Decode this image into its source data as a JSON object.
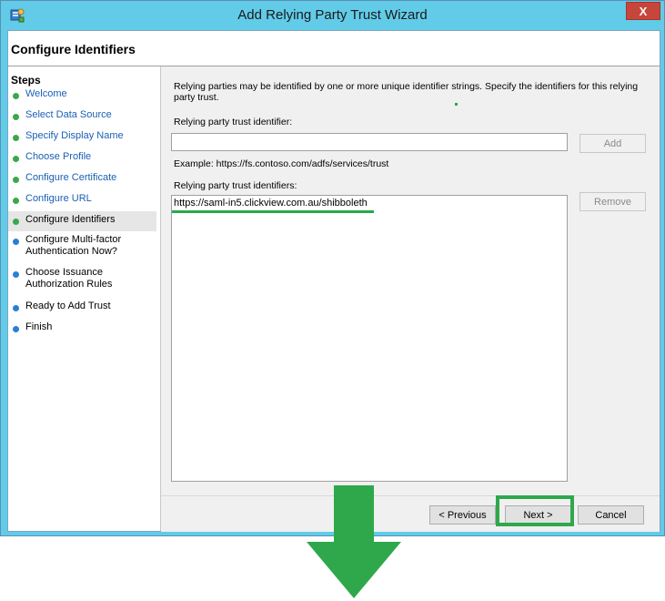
{
  "window": {
    "title": "Add Relying Party Trust Wizard",
    "close_label": "X"
  },
  "header": {
    "title": "Configure Identifiers"
  },
  "steps": {
    "title": "Steps",
    "items": [
      {
        "label": "Welcome",
        "state": "done"
      },
      {
        "label": "Select Data Source",
        "state": "done"
      },
      {
        "label": "Specify Display Name",
        "state": "done"
      },
      {
        "label": "Choose Profile",
        "state": "done"
      },
      {
        "label": "Configure Certificate",
        "state": "done"
      },
      {
        "label": "Configure URL",
        "state": "done"
      },
      {
        "label": "Configure Identifiers",
        "state": "current"
      },
      {
        "label": "Configure Multi-factor Authentication Now?",
        "state": "future"
      },
      {
        "label": "Choose Issuance Authorization Rules",
        "state": "future"
      },
      {
        "label": "Ready to Add Trust",
        "state": "future"
      },
      {
        "label": "Finish",
        "state": "future"
      }
    ]
  },
  "main": {
    "description": "Relying parties may be identified by one or more unique identifier strings. Specify the identifiers for this relying party trust.",
    "identifier_label": "Relying party trust identifier:",
    "identifier_value": "",
    "add_label": "Add",
    "example": "Example: https://fs.contoso.com/adfs/services/trust",
    "identifiers_label": "Relying party trust identifiers:",
    "identifiers": [
      "https://saml-in5.clickview.com.au/shibboleth"
    ],
    "remove_label": "Remove"
  },
  "footer": {
    "previous_label": "< Previous",
    "next_label": "Next >",
    "cancel_label": "Cancel"
  },
  "colors": {
    "done_dot": "#3aa84a",
    "future_dot": "#2a7fd4",
    "highlight": "#2ea84b",
    "titlebar": "#62cbe8"
  }
}
